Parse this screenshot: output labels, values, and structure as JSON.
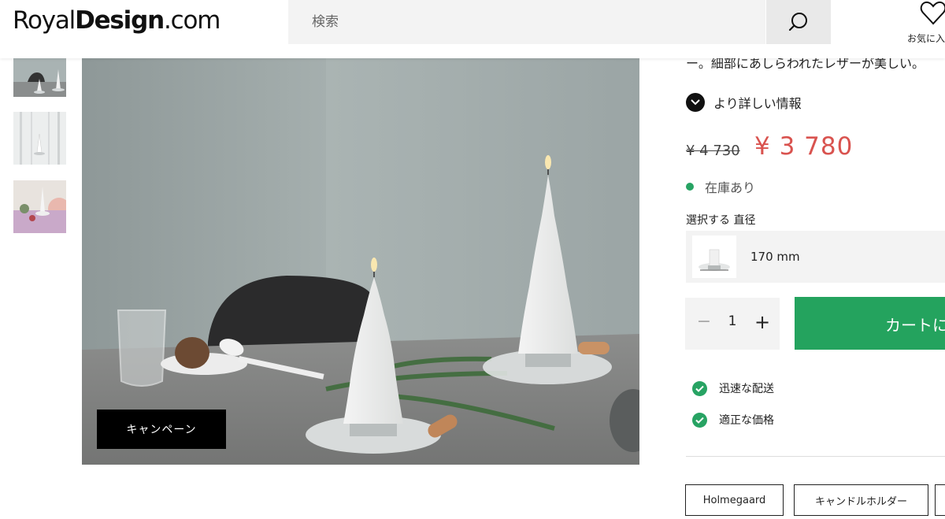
{
  "header": {
    "logo_part1": "Royal",
    "logo_part2": "Design",
    "logo_part3": ".com",
    "search_placeholder": "検索",
    "favorites_label": "お気に入"
  },
  "gallery": {
    "campaign_label": "キャンペーン"
  },
  "product": {
    "description_tail": "ー。細部にあしらわれたレザーが美しい。",
    "more_info_label": "より詳しい情報",
    "old_price": "¥ 4 730",
    "new_price": "¥ 3 780",
    "stock_status": "在庫あり",
    "select_label": "選択する 直径",
    "variant_value": "170 mm",
    "quantity": "1",
    "quantity_minus": "−",
    "quantity_plus": "+",
    "add_to_cart_label": "カートに",
    "features": [
      "迅速な配送",
      "適正な価格"
    ],
    "tags": [
      "Holmegaard",
      "キャンドルホルダー"
    ]
  },
  "colors": {
    "sale_price": "#d9534f",
    "in_stock": "#27a363",
    "cart_button": "#24a35e"
  },
  "icons": {
    "search": "search-icon",
    "favorite": "heart-icon",
    "more_info": "chevron-down-icon",
    "feature": "check-circle-icon"
  }
}
